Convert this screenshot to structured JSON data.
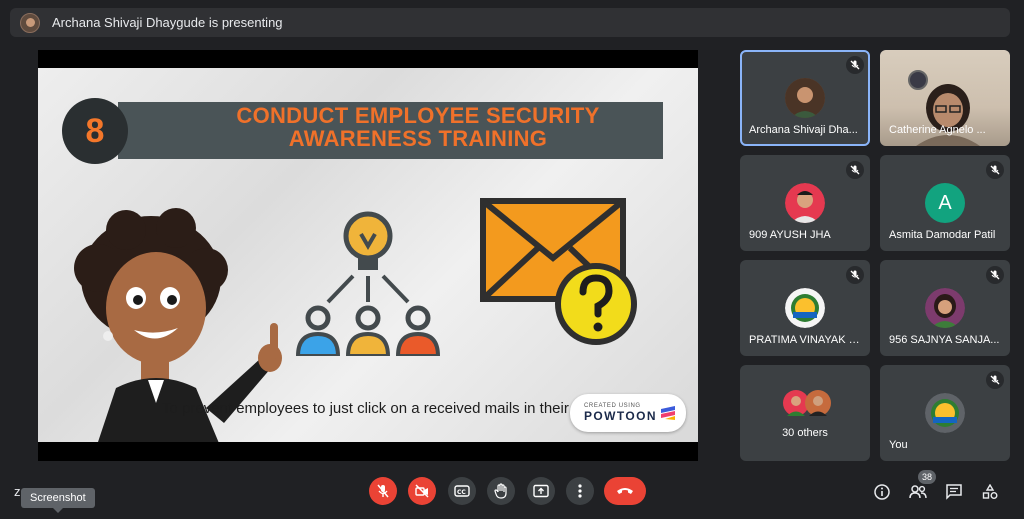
{
  "presenter_bar": {
    "text": "Archana Shivaji Dhaygude is presenting"
  },
  "slide": {
    "number": "8",
    "title_line1": "CONDUCT EMPLOYEE SECURITY",
    "title_line2": "AWARENESS TRAINING",
    "caption": "To prevent employees to just click on a received mails in their",
    "powtoon_small": "CREATED USING",
    "powtoon_big": "POWTOON"
  },
  "participants": [
    {
      "name": "Archana Shivaji Dha...",
      "muted": true,
      "active": true
    },
    {
      "name": "Catherine Agnelo ...",
      "muted": false,
      "camera": true
    },
    {
      "name": "909 AYUSH JHA",
      "muted": true
    },
    {
      "name": "Asmita Damodar Patil",
      "muted": true,
      "initial": "A",
      "color": "#12a37f"
    },
    {
      "name": "PRATIMA VINAYAK G...",
      "muted": true
    },
    {
      "name": "956 SAJNYA SANJA...",
      "muted": true
    },
    {
      "name": "30 others"
    },
    {
      "name": "You",
      "muted": true
    }
  ],
  "bottom": {
    "meeting_code": "z",
    "tooltip": "Screenshot",
    "people_count": "38"
  },
  "colors": {
    "accent": "#8ab4f8",
    "danger": "#ea4335",
    "tile": "#3c4043",
    "background": "#202124"
  }
}
